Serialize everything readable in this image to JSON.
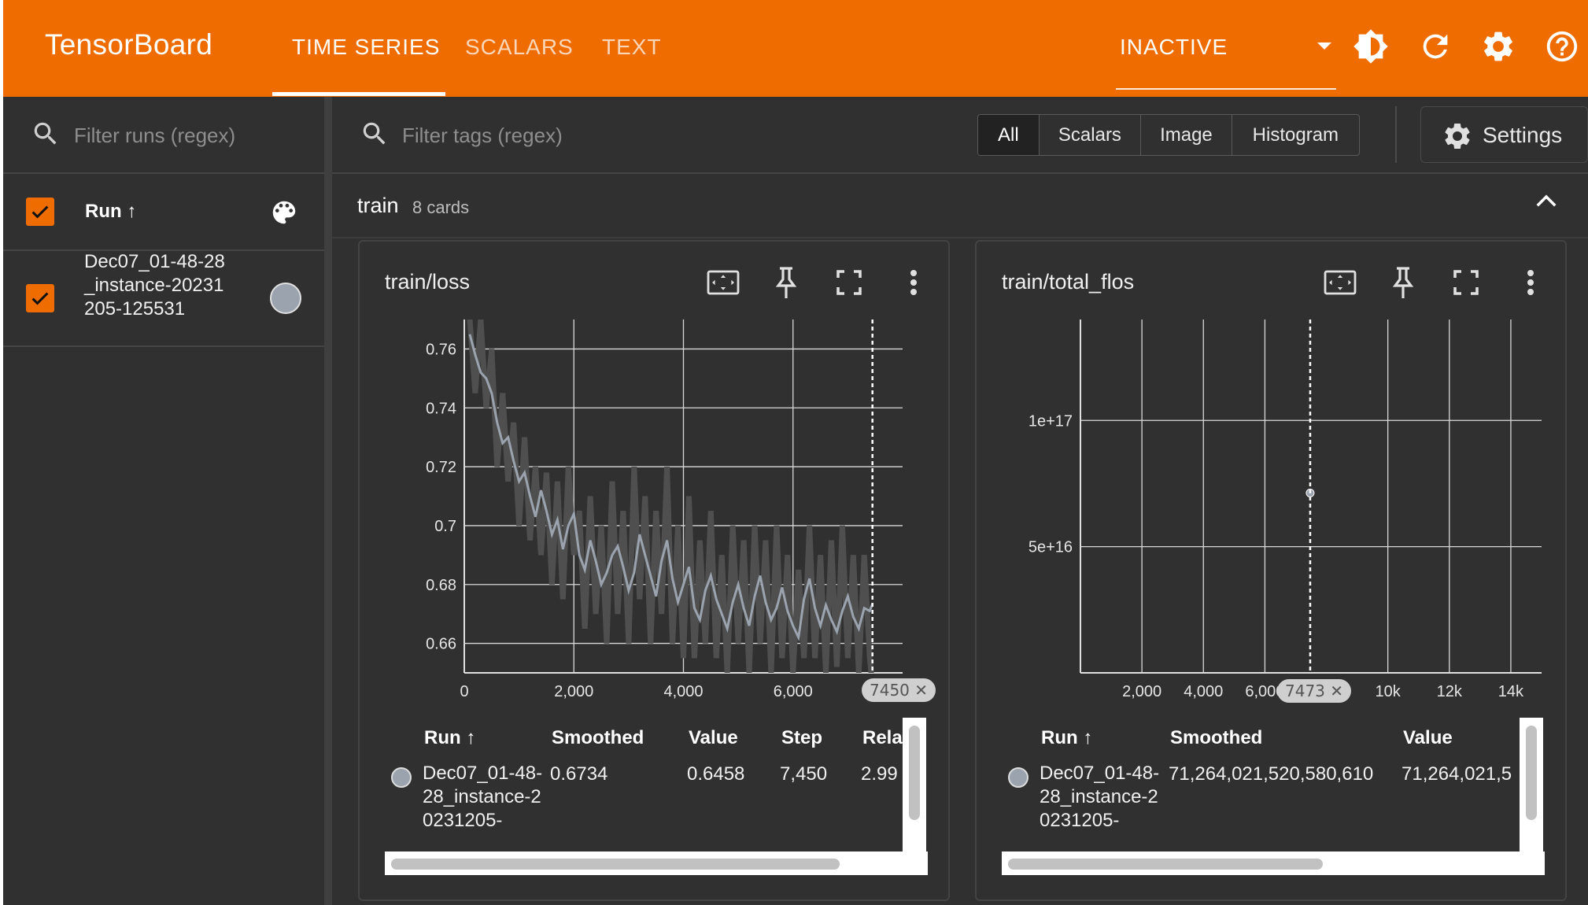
{
  "header": {
    "brand": "TensorBoard",
    "tabs": [
      {
        "label": "TIME SERIES",
        "active": true
      },
      {
        "label": "SCALARS",
        "active": false
      },
      {
        "label": "TEXT",
        "active": false
      }
    ],
    "status_dropdown": "INACTIVE",
    "icons": [
      "theme-toggle-icon",
      "refresh-icon",
      "settings-icon",
      "help-icon"
    ],
    "accent_color": "#ef6c00"
  },
  "sidebar": {
    "filter_placeholder": "Filter runs (regex)",
    "run_column_label": "Run",
    "runs": [
      {
        "name": "Dec07_01-48-28_instance-20231205-125531",
        "checked": true,
        "color": "#9aa3ae"
      }
    ]
  },
  "main": {
    "filter_placeholder": "Filter tags (regex)",
    "type_filters": [
      {
        "label": "All",
        "active": true
      },
      {
        "label": "Scalars",
        "active": false
      },
      {
        "label": "Image",
        "active": false
      },
      {
        "label": "Histogram",
        "active": false
      }
    ],
    "settings_label": "Settings",
    "group": {
      "name": "train",
      "count_label": "8 cards"
    }
  },
  "cards": [
    {
      "title": "train/loss",
      "step_chip": "7450",
      "table": {
        "headers": [
          "Run",
          "Smoothed",
          "Value",
          "Step",
          "Rela"
        ],
        "row": {
          "run": "Dec07_01-48-28_instance-20231205-",
          "smoothed": "0.6734",
          "value": "0.6458",
          "step": "7,450",
          "relative": "2.99"
        }
      }
    },
    {
      "title": "train/total_flos",
      "step_chip": "7473",
      "table": {
        "headers": [
          "Run",
          "Smoothed",
          "Value"
        ],
        "row": {
          "run": "Dec07_01-48-28_instance-20231205-",
          "smoothed": "71,264,021,520,580,610",
          "value": "71,264,021,5"
        }
      }
    }
  ],
  "chart_data": [
    {
      "type": "line",
      "title": "train/loss",
      "xlabel": "",
      "ylabel": "",
      "x_ticks": [
        "0",
        "2,000",
        "4,000",
        "6,000"
      ],
      "y_ticks": [
        "0.66",
        "0.68",
        "0.7",
        "0.72",
        "0.74",
        "0.76"
      ],
      "xlim": [
        0,
        8000
      ],
      "ylim": [
        0.65,
        0.77
      ],
      "grid": true,
      "cursor_step": 7450,
      "series": [
        {
          "color": "#9aa3ae",
          "x": [
            100,
            200,
            300,
            400,
            500,
            600,
            700,
            800,
            900,
            1000,
            1100,
            1200,
            1300,
            1400,
            1500,
            1600,
            1700,
            1800,
            1900,
            2000,
            2100,
            2200,
            2300,
            2400,
            2500,
            2600,
            2700,
            2800,
            2900,
            3000,
            3100,
            3200,
            3300,
            3400,
            3500,
            3600,
            3700,
            3800,
            3900,
            4000,
            4100,
            4200,
            4300,
            4400,
            4500,
            4600,
            4700,
            4800,
            4900,
            5000,
            5100,
            5200,
            5300,
            5400,
            5500,
            5600,
            5700,
            5800,
            5900,
            6000,
            6100,
            6200,
            6300,
            6400,
            6500,
            6600,
            6700,
            6800,
            6900,
            7000,
            7100,
            7200,
            7300,
            7400,
            7450
          ],
          "smoothed": [
            0.765,
            0.758,
            0.752,
            0.75,
            0.745,
            0.735,
            0.728,
            0.73,
            0.722,
            0.715,
            0.718,
            0.71,
            0.703,
            0.712,
            0.705,
            0.697,
            0.702,
            0.692,
            0.7,
            0.704,
            0.69,
            0.685,
            0.695,
            0.688,
            0.68,
            0.684,
            0.69,
            0.693,
            0.686,
            0.678,
            0.684,
            0.697,
            0.69,
            0.683,
            0.676,
            0.688,
            0.695,
            0.682,
            0.674,
            0.68,
            0.686,
            0.672,
            0.668,
            0.678,
            0.683,
            0.675,
            0.67,
            0.665,
            0.674,
            0.68,
            0.672,
            0.666,
            0.676,
            0.683,
            0.674,
            0.668,
            0.672,
            0.679,
            0.671,
            0.666,
            0.662,
            0.675,
            0.682,
            0.672,
            0.666,
            0.673,
            0.668,
            0.664,
            0.671,
            0.676,
            0.669,
            0.665,
            0.672,
            0.671,
            0.6734
          ],
          "raw": [
            0.77,
            0.745,
            0.77,
            0.74,
            0.76,
            0.72,
            0.745,
            0.715,
            0.735,
            0.7,
            0.73,
            0.695,
            0.72,
            0.69,
            0.718,
            0.68,
            0.715,
            0.675,
            0.72,
            0.69,
            0.705,
            0.665,
            0.71,
            0.67,
            0.7,
            0.66,
            0.715,
            0.67,
            0.705,
            0.66,
            0.72,
            0.675,
            0.71,
            0.66,
            0.705,
            0.67,
            0.72,
            0.66,
            0.7,
            0.655,
            0.71,
            0.655,
            0.695,
            0.66,
            0.705,
            0.655,
            0.69,
            0.65,
            0.7,
            0.66,
            0.695,
            0.65,
            0.7,
            0.66,
            0.695,
            0.65,
            0.7,
            0.655,
            0.69,
            0.65,
            0.685,
            0.655,
            0.7,
            0.655,
            0.69,
            0.65,
            0.695,
            0.652,
            0.7,
            0.655,
            0.69,
            0.65,
            0.69,
            0.655,
            0.6458
          ]
        }
      ]
    },
    {
      "type": "scatter",
      "title": "train/total_flos",
      "xlabel": "",
      "ylabel": "",
      "x_ticks": [
        "2,000",
        "4,000",
        "6,000",
        "10k",
        "12k",
        "14k"
      ],
      "y_ticks": [
        "5e+16",
        "1e+17"
      ],
      "xlim": [
        0,
        15000
      ],
      "ylim": [
        0,
        1.4e+17
      ],
      "grid": true,
      "cursor_step": 7473,
      "series": [
        {
          "color": "#9aa3ae",
          "x": [
            7473
          ],
          "y": [
            71264021520580610
          ]
        }
      ]
    }
  ]
}
